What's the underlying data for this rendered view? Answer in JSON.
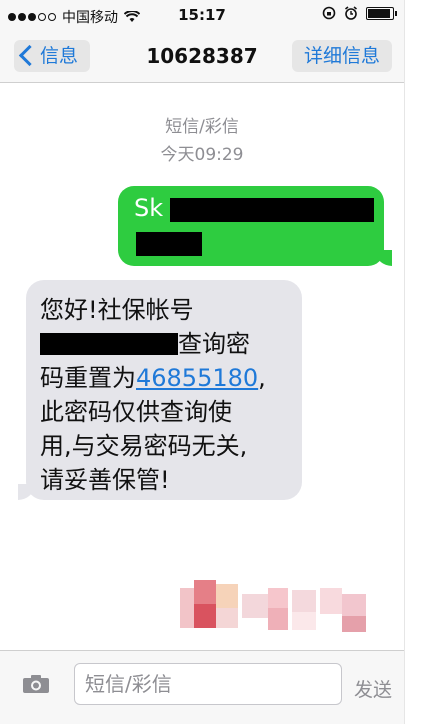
{
  "status_bar": {
    "carrier": "中国移动",
    "time": "15:17"
  },
  "nav": {
    "back_label": "信息",
    "title": "10628387",
    "detail_label": "详细信息"
  },
  "conversation": {
    "message_type": "短信/彩信",
    "timestamp": "今天09:29",
    "sent_message": {
      "visible_text": "Sk",
      "color": "#2ecc40"
    },
    "received_message": {
      "line1": "您好!社保帐号",
      "line2_suffix": "查询密",
      "line3_prefix": "码重置为",
      "line3_link": "46855180",
      "line3_suffix": ",",
      "line4": "此密码仅供查询使",
      "line5": "用,与交易密码无关,",
      "line6": "请妥善保管!"
    }
  },
  "composer": {
    "placeholder": "短信/彩信",
    "send_label": "发送"
  },
  "colors": {
    "accent": "#1f79d8",
    "received_bubble": "#e5e5ea"
  }
}
